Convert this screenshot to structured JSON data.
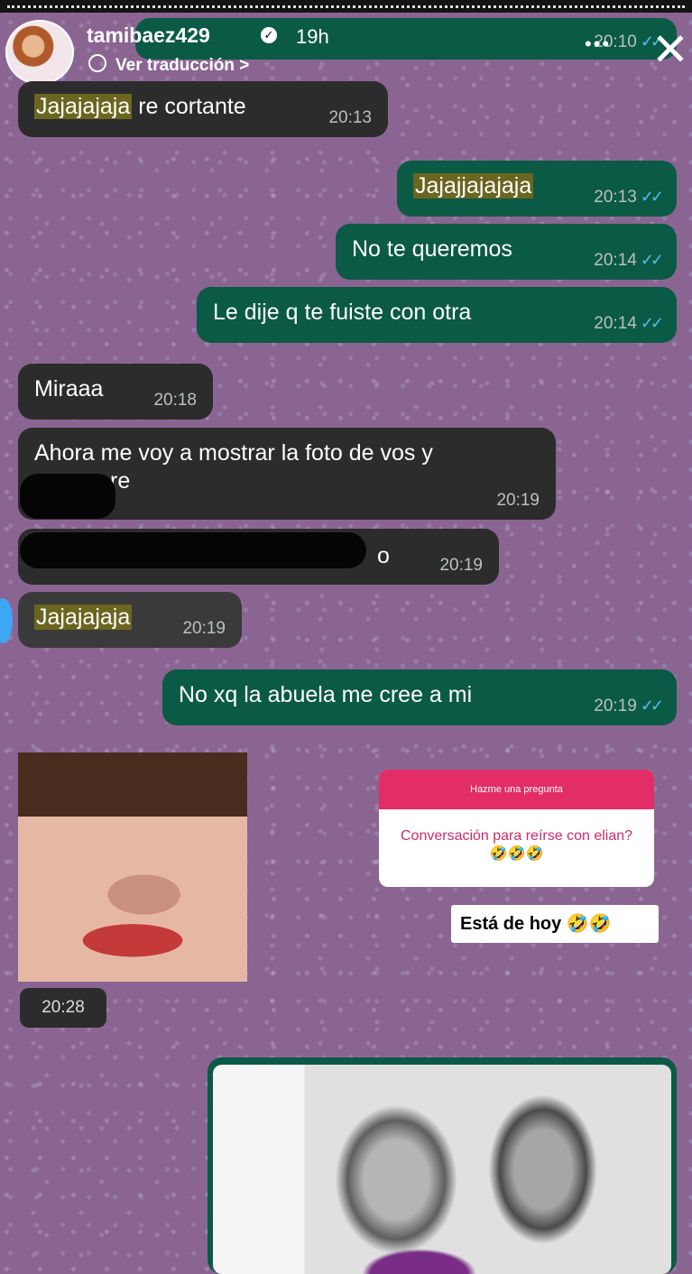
{
  "header": {
    "username": "tamibaez429",
    "verified_icon": "verified-badge-icon",
    "time_ago": "19h",
    "translate_label": "Ver traducción >",
    "more_icon": "more-dots-icon",
    "close_icon": "close-icon"
  },
  "messages": [
    {
      "dir": "in",
      "highlight": "Jajajajaja",
      "text": "re cortante",
      "time": "20:13"
    },
    {
      "dir": "out",
      "highlight": "Jajajjajajaja",
      "text": "",
      "time": "20:13"
    },
    {
      "dir": "out",
      "text": "No te queremos",
      "time": "20:14"
    },
    {
      "dir": "out",
      "text": "Le dije q te fuiste con otra",
      "time": "20:14"
    },
    {
      "dir": "in",
      "text": "Miraaa",
      "time": "20:18"
    },
    {
      "dir": "in",
      "text": "Ahora me voy a mostrar la foto de vos y",
      "text2": "re",
      "time": "20:19"
    },
    {
      "dir": "in",
      "text": "o",
      "time": "20:19"
    },
    {
      "dir": "in",
      "highlight": "Jajajajaja",
      "text": "",
      "time": "20:19"
    },
    {
      "dir": "out",
      "text": "No xq la abuela me cree a mi",
      "time": "20:19"
    }
  ],
  "top_partial_time": "20:10",
  "photo_time": "20:28",
  "question_sticker": {
    "header": "Hazme una pregunta",
    "question": "Conversación para reírse con elian?🤣🤣🤣"
  },
  "answer_sticker": "Está de hoy 🤣🤣",
  "colors": {
    "incoming": "#2c2c2c",
    "outgoing": "#0b5a45",
    "ticks": "#53bdeb",
    "question_header": "#e22d66"
  }
}
